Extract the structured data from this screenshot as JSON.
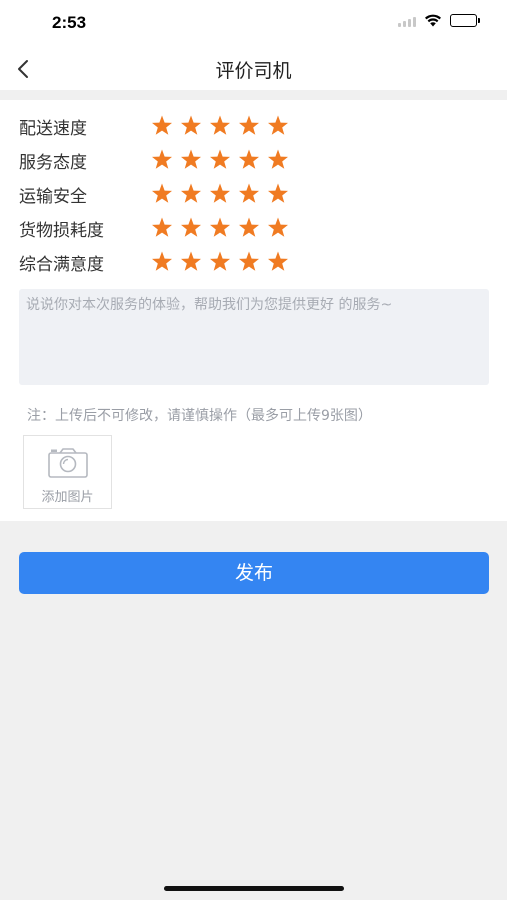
{
  "status_bar": {
    "time": "2:53",
    "battery_level": 1.0,
    "icons": [
      "signal-icon",
      "wifi-icon",
      "battery-icon"
    ]
  },
  "nav": {
    "title": "评价司机",
    "back_icon": "chevron-left-icon"
  },
  "ratings": [
    {
      "label": "配送速度",
      "stars": 5,
      "max": 5
    },
    {
      "label": "服务态度",
      "stars": 5,
      "max": 5
    },
    {
      "label": "运输安全",
      "stars": 5,
      "max": 5
    },
    {
      "label": "货物损耗度",
      "stars": 5,
      "max": 5
    },
    {
      "label": "综合满意度",
      "stars": 5,
      "max": 5
    }
  ],
  "comment": {
    "placeholder": "说说你对本次服务的体验，帮助我们为您提供更好 的服务~",
    "value": ""
  },
  "note": "注：上传后不可修改，请谨慎操作（最多可上传9张图）",
  "upload": {
    "label": "添加图片",
    "icon": "camera-icon"
  },
  "publish_label": "发布",
  "colors": {
    "star": "#f07b22",
    "primary": "#3485f2",
    "background": "#f0f0f0"
  }
}
